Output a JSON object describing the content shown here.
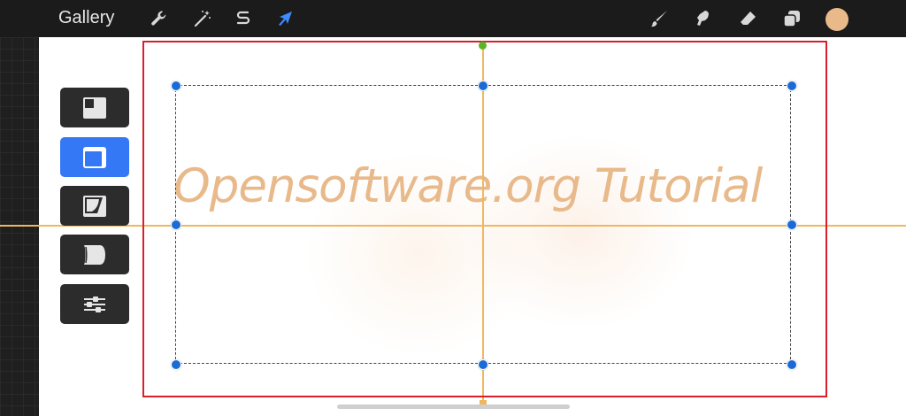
{
  "topbar": {
    "gallery_label": "Gallery",
    "left_tools": [
      {
        "icon": "wrench-icon",
        "name": "actions"
      },
      {
        "icon": "magic-wand-icon",
        "name": "adjustments"
      },
      {
        "icon": "selection-s-icon",
        "name": "selection"
      },
      {
        "icon": "arrow-cursor-icon",
        "name": "transform",
        "active": true
      }
    ],
    "right_tools": [
      {
        "icon": "brush-icon",
        "name": "paint"
      },
      {
        "icon": "smudge-icon",
        "name": "smudge"
      },
      {
        "icon": "eraser-icon",
        "name": "erase"
      },
      {
        "icon": "layers-icon",
        "name": "layers"
      }
    ],
    "active_color": "#eab98a"
  },
  "canvas": {
    "watermark_text": "Opensoftware.org Tutorial",
    "watermark_color": "#e8b98a",
    "guide_color": "#f0b760",
    "frame_color": "#d9202a"
  },
  "side_toolbar": {
    "buttons": [
      {
        "icon": "snap-left-icon",
        "active": false
      },
      {
        "icon": "snap-top-right-icon",
        "active": true
      },
      {
        "icon": "distort-icon",
        "active": false
      },
      {
        "icon": "warp-icon",
        "active": false
      },
      {
        "icon": "settings-sliders-icon",
        "active": false
      }
    ],
    "active_color": "#3478f6"
  }
}
